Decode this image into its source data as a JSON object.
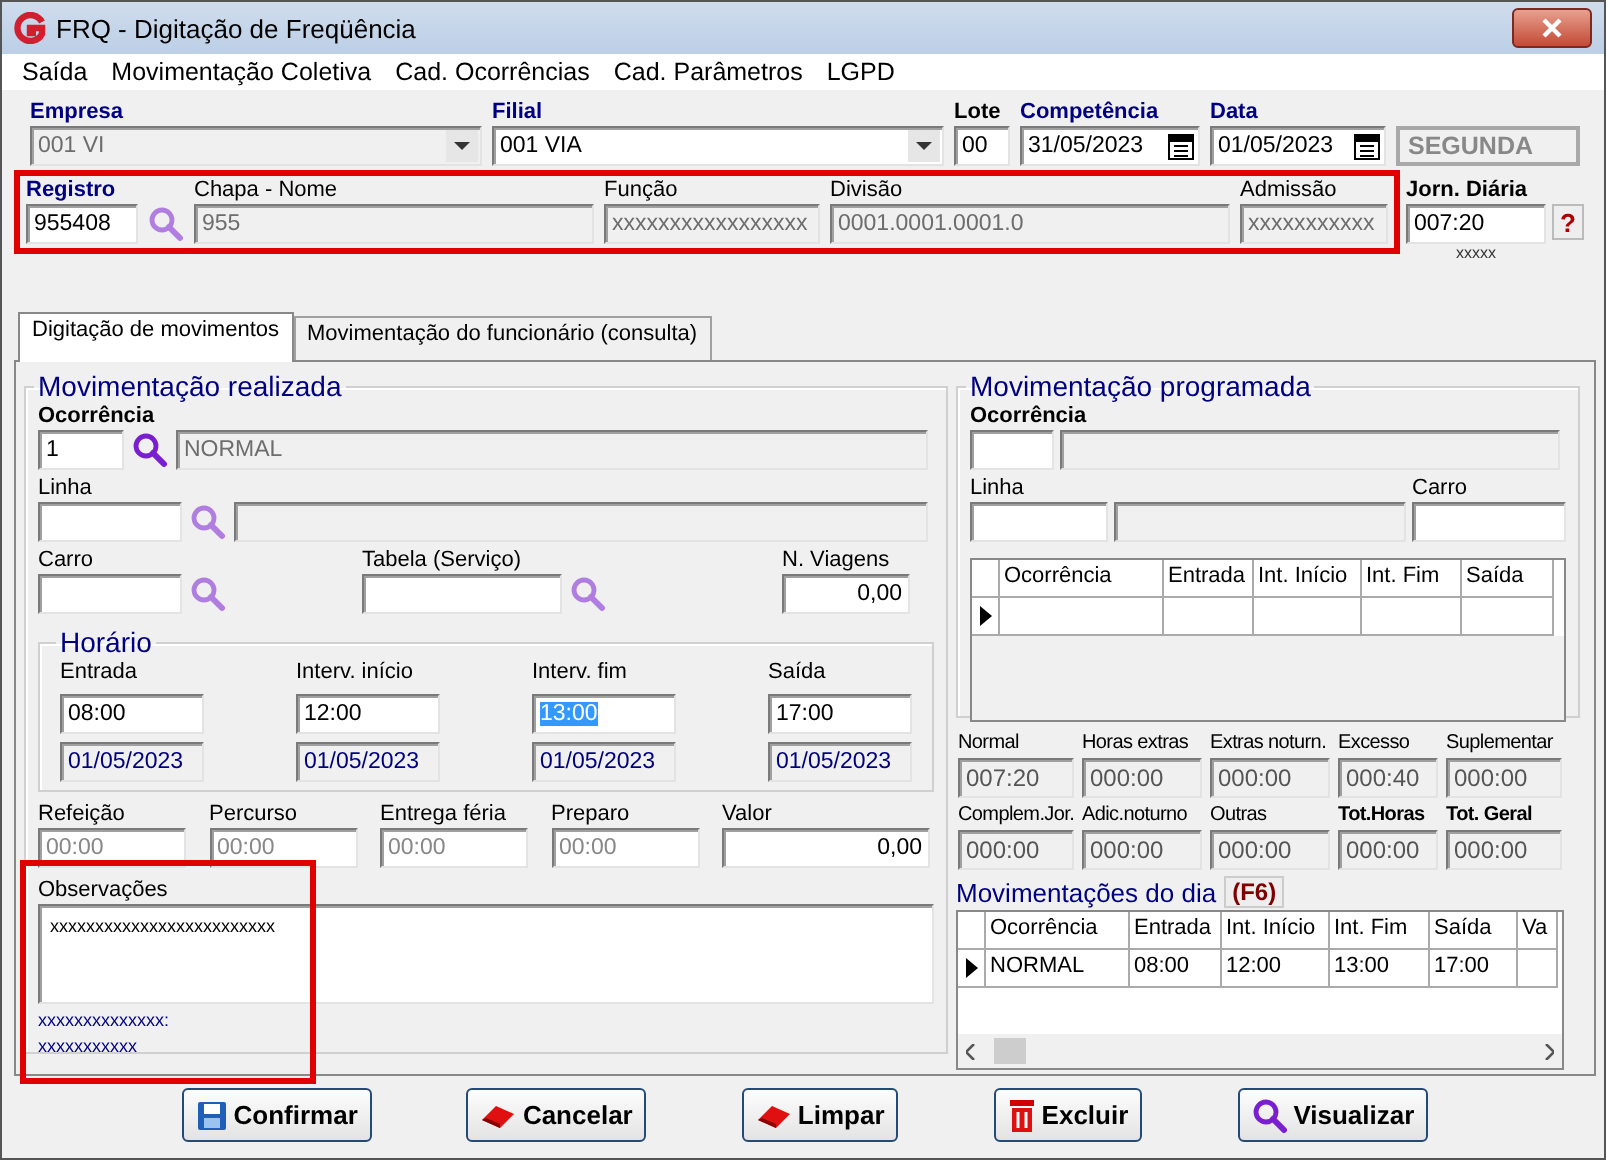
{
  "window": {
    "title": "FRQ - Digitação de Freqüência"
  },
  "menu": [
    {
      "label": "Saída"
    },
    {
      "label": "Movimentação Coletiva"
    },
    {
      "label": "Cad. Ocorrências"
    },
    {
      "label": "Cad. Parâmetros"
    },
    {
      "label": "LGPD"
    }
  ],
  "header": {
    "empresa": {
      "label": "Empresa",
      "value": "001 VI"
    },
    "filial": {
      "label": "Filial",
      "value": "001 VIA"
    },
    "lote": {
      "label": "Lote",
      "value": "00"
    },
    "competencia": {
      "label": "Competência",
      "value": "31/05/2023"
    },
    "data": {
      "label": "Data",
      "value": "01/05/2023"
    },
    "weekday": "SEGUNDA",
    "registro": {
      "label": "Registro",
      "value": "955408"
    },
    "chapa_nome": {
      "label": "Chapa  -  Nome",
      "value": "955"
    },
    "funcao": {
      "label": "Função",
      "value": "xxxxxxxxxxxxxxxxx"
    },
    "divisao": {
      "label": "Divisão",
      "value": "0001.0001.0001.0"
    },
    "admissao": {
      "label": "Admissão",
      "value": "xxxxxxxxxxx"
    },
    "jornada": {
      "label": "Jorn. Diária",
      "value": "007:20",
      "note": "xxxxx"
    },
    "help": "?"
  },
  "tabs": [
    {
      "label": "Digitação de movimentos",
      "selected": true
    },
    {
      "label": "Movimentação do funcionário (consulta)",
      "selected": false
    }
  ],
  "realizada": {
    "title": "Movimentação realizada",
    "ocorrencia": {
      "label": "Ocorrência",
      "code": "1",
      "description": "NORMAL"
    },
    "linha": {
      "label": "Linha"
    },
    "carro": {
      "label": "Carro"
    },
    "tabela": {
      "label": "Tabela (Serviço)"
    },
    "viagens": {
      "label": "N. Viagens",
      "value": "0,00"
    },
    "horario": {
      "title": "Horário",
      "columns": [
        {
          "label": "Entrada",
          "time": "08:00",
          "date": "01/05/2023",
          "selected": false
        },
        {
          "label": "Interv. início",
          "time": "12:00",
          "date": "01/05/2023",
          "selected": false
        },
        {
          "label": "Interv. fim",
          "time": "13:00",
          "date": "01/05/2023",
          "selected": true
        },
        {
          "label": "Saída",
          "time": "17:00",
          "date": "01/05/2023",
          "selected": false
        }
      ]
    },
    "extras": [
      {
        "label": "Refeição",
        "value": "00:00",
        "kind": "time"
      },
      {
        "label": "Percurso",
        "value": "00:00",
        "kind": "time"
      },
      {
        "label": "Entrega féria",
        "value": "00:00",
        "kind": "time"
      },
      {
        "label": "Preparo",
        "value": "00:00",
        "kind": "time"
      },
      {
        "label": "Valor",
        "value": "0,00",
        "kind": "number"
      }
    ],
    "observacoes": {
      "label": "Observações",
      "text": "xxxxxxxxxxxxxxxxxxxxxxxxx",
      "notes": [
        "xxxxxxxxxxxxxx:",
        "xxxxxxxxxxx"
      ]
    }
  },
  "programada": {
    "title": "Movimentação programada",
    "ocorrencia": {
      "label": "Ocorrência"
    },
    "linha": {
      "label": "Linha"
    },
    "carro": {
      "label": "Carro"
    },
    "grid": {
      "columns": [
        "Ocorrência",
        "Entrada",
        "Int. Início",
        "Int. Fim",
        "Saída"
      ]
    }
  },
  "totals": [
    {
      "label": "Normal",
      "value": "007:20",
      "kind": "plain"
    },
    {
      "label": "Horas extras",
      "value": "000:00",
      "kind": "plain"
    },
    {
      "label": "Extras noturn.",
      "value": "000:00",
      "kind": "plain"
    },
    {
      "label": "Excesso",
      "value": "000:40",
      "kind": "plain"
    },
    {
      "label": "Suplementar",
      "value": "000:00",
      "kind": "plain"
    },
    {
      "label": "Complem.Jor.",
      "value": "000:00",
      "kind": "plain"
    },
    {
      "label": "Adic.noturno",
      "value": "000:00",
      "kind": "plain"
    },
    {
      "label": "Outras",
      "value": "000:00",
      "kind": "plain"
    },
    {
      "label": "Tot.Horas",
      "value": "000:00",
      "kind": "total"
    },
    {
      "label": "Tot. Geral",
      "value": "000:00",
      "kind": "total"
    }
  ],
  "movimentacoes_dia": {
    "title": "Movimentações do dia",
    "shortcut": "(F6)",
    "columns": [
      "Ocorrência",
      "Entrada",
      "Int. Início",
      "Int. Fim",
      "Saída",
      "Va"
    ],
    "rows": [
      {
        "cells": [
          "NORMAL",
          "08:00",
          "12:00",
          "13:00",
          "17:00"
        ],
        "selected": true
      }
    ]
  },
  "buttons": [
    {
      "label": "Confirmar",
      "kind": "save"
    },
    {
      "label": "Cancelar",
      "kind": "eraser"
    },
    {
      "label": "Limpar",
      "kind": "eraser"
    },
    {
      "label": "Excluir",
      "kind": "trash"
    },
    {
      "label": "Visualizar",
      "kind": "search"
    }
  ]
}
